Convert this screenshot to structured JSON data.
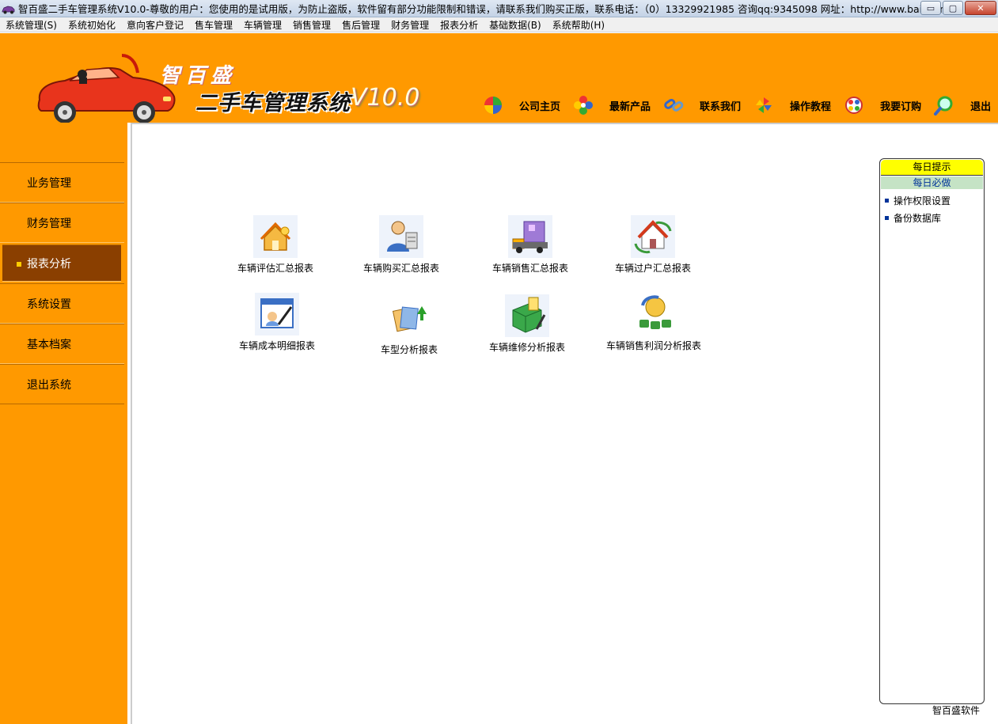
{
  "window": {
    "title": "智百盛二手车管理系统V10.0-尊敬的用户：您使用的是试用版，为防止盗版，软件留有部分功能限制和错误，请联系我们购买正版，联系电话：（0）13329921985 咨询qq:9345098  网址：http://www.baishen...",
    "minimize_glyph": "▭",
    "maximize_glyph": "▢",
    "close_glyph": "✕"
  },
  "menu": [
    "系统管理(S)",
    "系统初始化",
    "意向客户登记",
    "售车管理",
    "车辆管理",
    "销售管理",
    "售后管理",
    "财务管理",
    "报表分析",
    "基础数据(B)",
    "系统帮助(H)"
  ],
  "brand": {
    "small": "智百盛",
    "main": "二手车管理系统",
    "version": "V10.0"
  },
  "topnav": [
    {
      "label": "公司主页",
      "icon": "color-wheel-icon"
    },
    {
      "label": "最新产品",
      "icon": "flower-icon"
    },
    {
      "label": "联系我们",
      "icon": "chain-link-icon"
    },
    {
      "label": "操作教程",
      "icon": "pinwheel-icon"
    },
    {
      "label": "我要订购",
      "icon": "palette-icon"
    },
    {
      "label": "退出",
      "icon": "magnifier-icon"
    }
  ],
  "sidebar": [
    {
      "label": "业务管理",
      "active": false
    },
    {
      "label": "财务管理",
      "active": false
    },
    {
      "label": "报表分析",
      "active": true
    },
    {
      "label": "系统设置",
      "active": false
    },
    {
      "label": "基本档案",
      "active": false
    },
    {
      "label": "退出系统",
      "active": false
    }
  ],
  "reports": [
    {
      "label": "车辆评估汇总报表",
      "icon": "house-evaluation-icon"
    },
    {
      "label": "车辆购买汇总报表",
      "icon": "buyer-person-icon"
    },
    {
      "label": "车辆销售汇总报表",
      "icon": "truck-delivery-icon"
    },
    {
      "label": "车辆过户汇总报表",
      "icon": "house-transfer-icon"
    },
    {
      "label": "车辆成本明细报表",
      "icon": "chart-cost-icon"
    },
    {
      "label": "车型分析报表",
      "icon": "documents-upload-icon"
    },
    {
      "label": "车辆维修分析报表",
      "icon": "repair-box-icon"
    },
    {
      "label": "车辆销售利润分析报表",
      "icon": "money-profit-icon"
    }
  ],
  "tips": {
    "title": "每日提示",
    "subtitle": "每日必做",
    "items": [
      "操作权限设置",
      "备份数据库"
    ]
  },
  "footer": "智百盛软件",
  "colors": {
    "accent_orange": "#ff9900",
    "sidebar_active": "#8a3f00",
    "tips_title": "#ffff00"
  }
}
